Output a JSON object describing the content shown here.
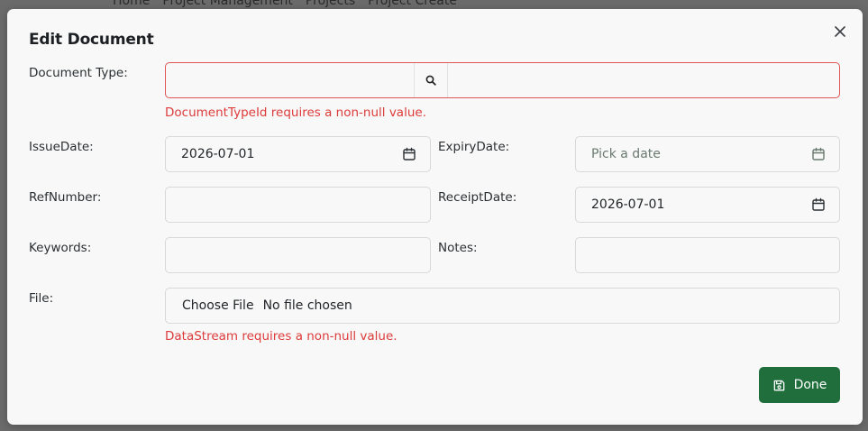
{
  "background": {
    "breadcrumb": [
      "Home",
      "Project Management",
      "Projects",
      "Project Create"
    ]
  },
  "modal": {
    "title": "Edit Document",
    "close_icon": "close-icon"
  },
  "form": {
    "document_type": {
      "label": "Document Type:",
      "value": "",
      "error": "DocumentTypeId requires a non-null value."
    },
    "issue_date": {
      "label": "IssueDate:",
      "value": "2026-07-01"
    },
    "expiry_date": {
      "label": "ExpiryDate:",
      "value": "",
      "placeholder": "Pick a date"
    },
    "ref_number": {
      "label": "RefNumber:",
      "value": ""
    },
    "receipt_date": {
      "label": "ReceiptDate:",
      "value": "2026-07-01"
    },
    "keywords": {
      "label": "Keywords:",
      "value": ""
    },
    "notes": {
      "label": "Notes:",
      "value": ""
    },
    "file": {
      "label": "File:",
      "button": "Choose File",
      "status": "No file chosen",
      "error": "DataStream requires a non-null value."
    }
  },
  "footer": {
    "done_label": "Done"
  },
  "colors": {
    "error": "#de3b3b",
    "primary": "#1f6e3c"
  }
}
